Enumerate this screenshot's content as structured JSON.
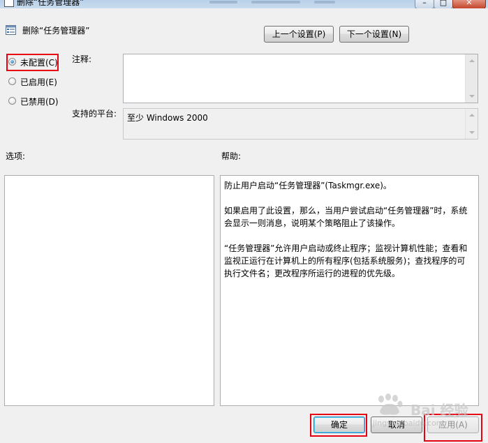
{
  "window": {
    "title": "删除“任务管理器”",
    "controls": {
      "minimize_icon": "minimize-icon",
      "maximize_icon": "maximize-icon",
      "close_icon": "close-icon"
    }
  },
  "header": {
    "policy_title": "删除“任务管理器”",
    "prev_button": "上一个设置(P)",
    "next_button": "下一个设置(N)"
  },
  "state": {
    "options": [
      {
        "label": "未配置(C)",
        "checked": true
      },
      {
        "label": "已启用(E)",
        "checked": false
      },
      {
        "label": "已禁用(D)",
        "checked": false
      }
    ]
  },
  "comment": {
    "label": "注释:",
    "value": ""
  },
  "platform": {
    "label": "支持的平台:",
    "value": "至少 Windows 2000"
  },
  "options_section": {
    "label": "选项:"
  },
  "help": {
    "label": "帮助:",
    "paragraphs": [
      "防止用户启动“任务管理器”(Taskmgr.exe)。",
      "如果启用了此设置，那么，当用户尝试启动“任务管理器”时，系统会显示一则消息，说明某个策略阻止了该操作。",
      "“任务管理器”允许用户启动或终止程序；监视计算机性能；查看和监视正运行在计算机上的所有程序(包括系统服务)；查找程序的可执行文件名；更改程序所运行的进程的优先级。"
    ]
  },
  "footer": {
    "ok_button": "确定",
    "cancel_button": "取消",
    "apply_button": "应用(A)"
  },
  "watermark": {
    "text": "Bai 经验",
    "url": "jingyan.baidu.com"
  },
  "colors": {
    "highlight_red": "#e60012",
    "default_button_border": "#3c7fb1"
  }
}
